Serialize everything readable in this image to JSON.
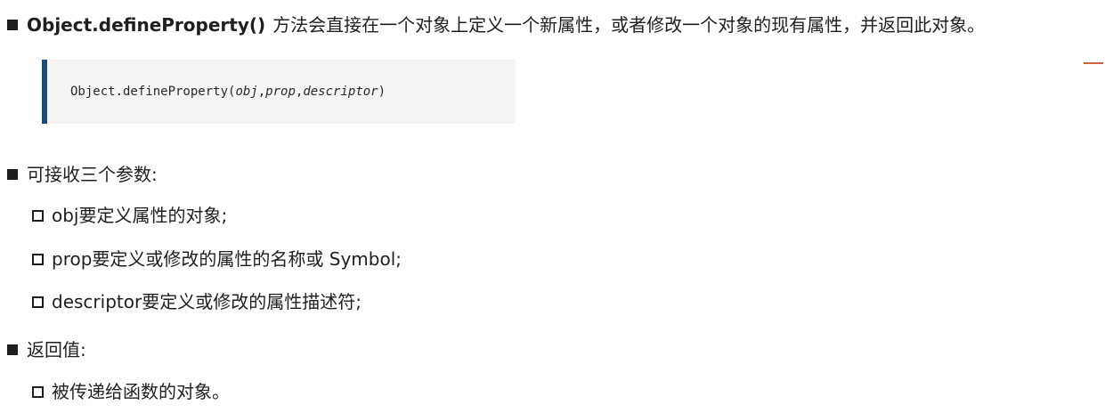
{
  "intro": {
    "method_name": "Object.defineProperty()",
    "description": "方法会直接在一个对象上定义一个新属性，或者修改一个对象的现有属性，并返回此对象。"
  },
  "code": {
    "prefix": "Object.defineProperty(",
    "param1": "obj",
    "sep1": ", ",
    "param2": "prop",
    "sep2": ", ",
    "param3": "descriptor",
    "suffix": ")"
  },
  "params_section": {
    "heading": "可接收三个参数:",
    "items": [
      "obj要定义属性的对象;",
      "prop要定义或修改的属性的名称或 Symbol;",
      "descriptor要定义或修改的属性描述符;"
    ]
  },
  "return_section": {
    "heading": "返回值:",
    "items": [
      "被传递给函数的对象。"
    ]
  },
  "colors": {
    "code_border": "#1f4a73",
    "code_background": "#f4f4f4",
    "accent_dash": "#d4603a"
  }
}
